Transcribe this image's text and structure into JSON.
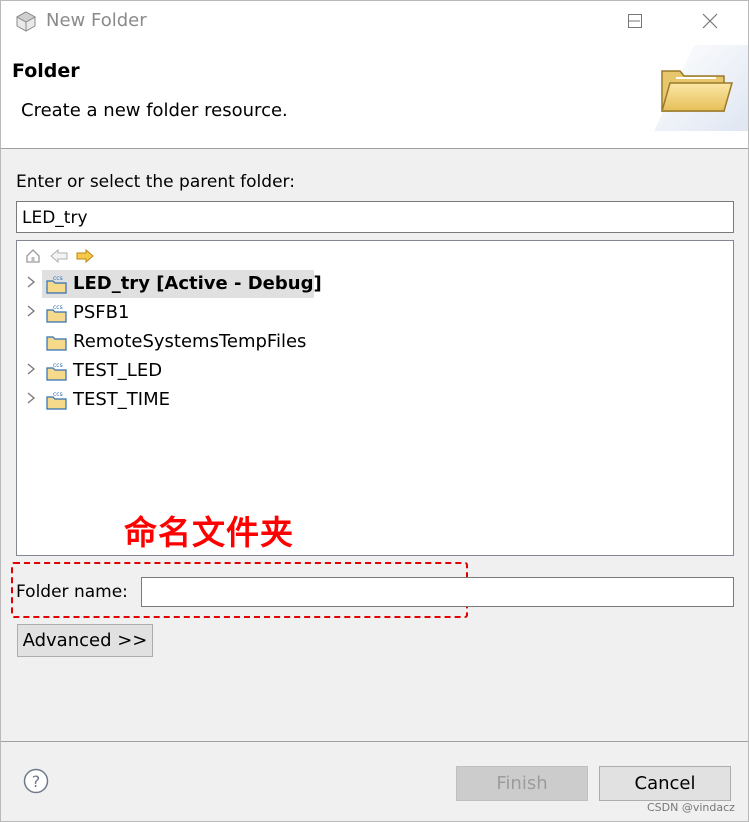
{
  "window": {
    "title": "New Folder",
    "icons": {
      "app": "app-cube-icon",
      "minimize": "minimize-icon",
      "maximize": "maximize-icon",
      "close": "close-icon"
    }
  },
  "banner": {
    "title": "Folder",
    "description": "Create a new folder resource.",
    "icon": "open-folder-icon"
  },
  "parent": {
    "label": "Enter or select the parent folder:",
    "value": "LED_try"
  },
  "tree": {
    "toolbar": [
      "home-icon",
      "back-arrow-icon",
      "forward-arrow-icon"
    ],
    "items": [
      {
        "label": "LED_try  [Active - Debug]",
        "expandable": true,
        "selected": true,
        "icon": "ccs-project-icon"
      },
      {
        "label": "PSFB1",
        "expandable": true,
        "selected": false,
        "icon": "ccs-project-icon"
      },
      {
        "label": "RemoteSystemsTempFiles",
        "expandable": false,
        "selected": false,
        "icon": "project-folder-icon"
      },
      {
        "label": "TEST_LED",
        "expandable": true,
        "selected": false,
        "icon": "ccs-project-icon"
      },
      {
        "label": "TEST_TIME",
        "expandable": true,
        "selected": false,
        "icon": "ccs-project-icon"
      }
    ]
  },
  "annotation": {
    "text": "命名文件夹",
    "color": "#ff0000"
  },
  "folder_name": {
    "label": "Folder name:",
    "value": ""
  },
  "buttons": {
    "advanced": "Advanced >>",
    "finish": "Finish",
    "cancel": "Cancel",
    "help_icon": "help-icon"
  },
  "watermark": "CSDN @vindacz"
}
